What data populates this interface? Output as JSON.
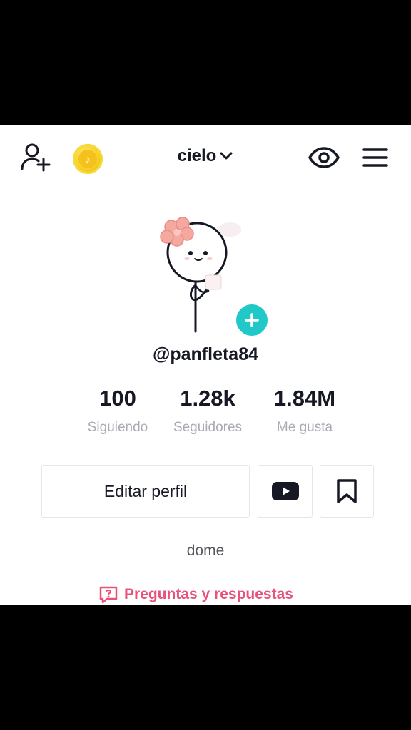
{
  "header": {
    "account_name": "cielo",
    "coin_glyph": "♪",
    "icons": [
      "add-user-icon",
      "coin-icon",
      "chevron-down-icon",
      "eye-icon",
      "menu-icon"
    ]
  },
  "profile": {
    "username": "@panfleta84",
    "bio": "dome"
  },
  "stats": {
    "following": {
      "value": "100",
      "label": "Siguiendo"
    },
    "followers": {
      "value": "1.28k",
      "label": "Seguidores"
    },
    "likes": {
      "value": "1.84M",
      "label": "Me gusta"
    }
  },
  "actions": {
    "edit_profile_label": "Editar perfil"
  },
  "qa": {
    "label": "Preguntas y respuestas"
  },
  "colors": {
    "accent_teal": "#20c9c8",
    "qa_pink": "#e8537a",
    "coin_gold": "#f6cf22",
    "text_primary": "#161823",
    "text_secondary": "#a9abb3"
  }
}
